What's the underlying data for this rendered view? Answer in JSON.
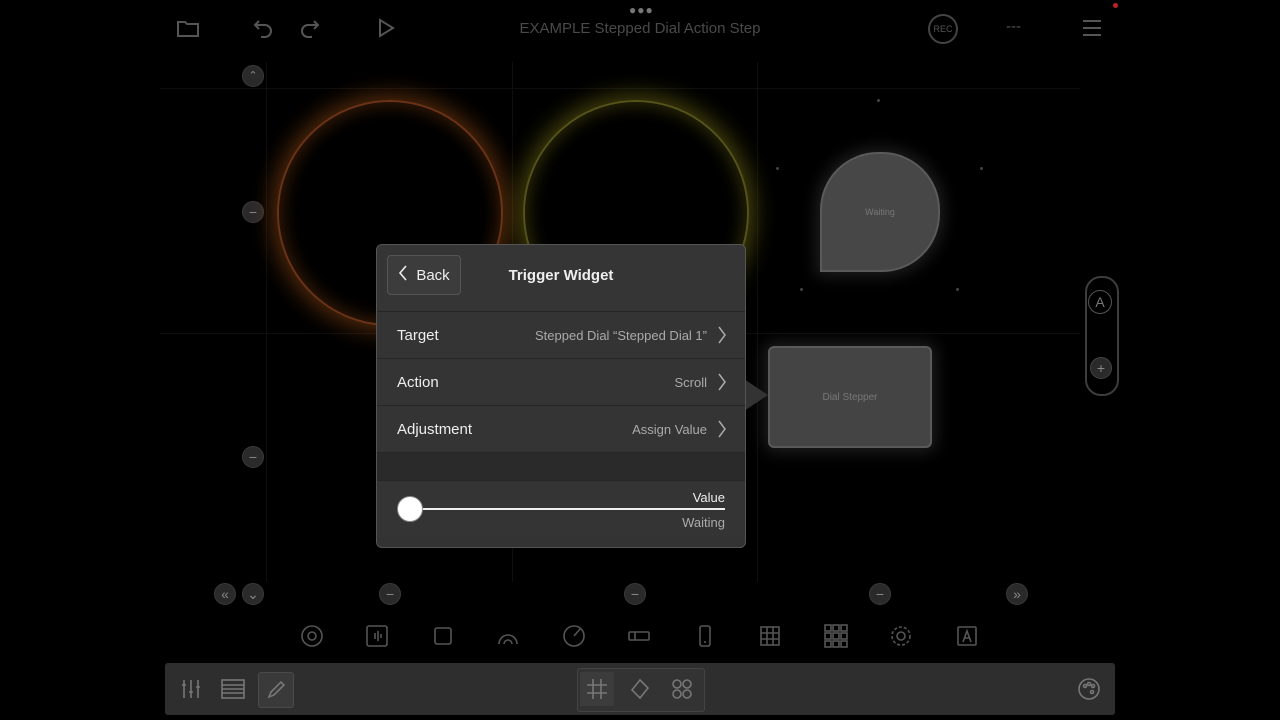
{
  "header": {
    "title": "EXAMPLE Stepped Dial Action Step",
    "rec_label": "REC",
    "status_text": "---"
  },
  "canvas": {
    "drop_widget_label": "Waiting",
    "stepper_widget_label": "Dial Stepper",
    "side_panel_letter": "A",
    "plus_symbol": "+",
    "minus_symbol": "−",
    "scroll_left_symbol": "«",
    "scroll_down_symbol": "⌄",
    "scroll_right_symbol": "»"
  },
  "popover": {
    "back_label": "Back",
    "title": "Trigger Widget",
    "rows": [
      {
        "label": "Target",
        "value": "Stepped Dial “Stepped Dial 1”"
      },
      {
        "label": "Action",
        "value": "Scroll"
      },
      {
        "label": "Adjustment",
        "value": "Assign Value"
      }
    ],
    "slider": {
      "label": "Value",
      "status": "Waiting",
      "position": 0
    }
  },
  "widget_bar": {
    "icons": [
      "dial-icon",
      "waveform-icon",
      "square-button-icon",
      "arc-icon",
      "knob-icon",
      "slider-icon",
      "phone-icon",
      "grid-icon",
      "pad-grid-icon",
      "ring-dial-icon",
      "text-icon"
    ]
  },
  "toolbar": {
    "left_tools": [
      "mixer-icon",
      "list-icon",
      "pencil-icon"
    ],
    "segments": [
      "grid-icon",
      "shape-icon",
      "pads-icon"
    ],
    "right_tools": [
      "palette-icon"
    ]
  },
  "colors": {
    "background": "#000000",
    "popover_bg": "#333333",
    "ring_orange": "#6a3318",
    "ring_yellow": "#55531a"
  }
}
